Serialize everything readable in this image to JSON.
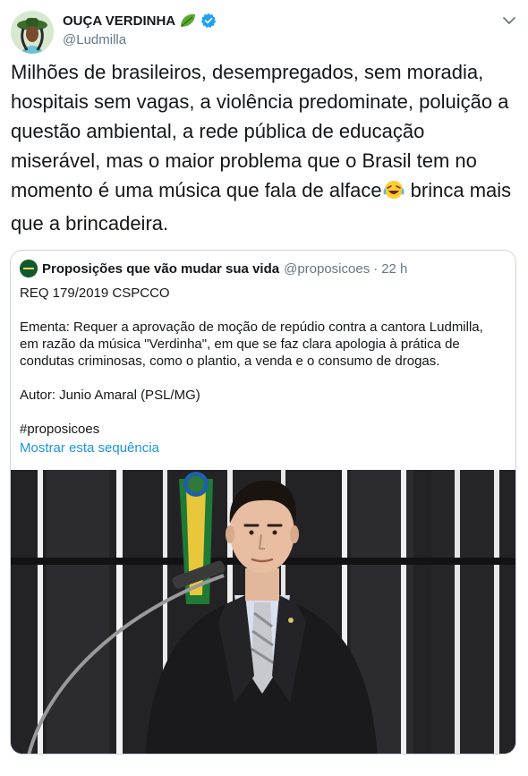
{
  "tweet": {
    "display_name": "OUÇA VERDINHA",
    "handle": "@Ludmilla",
    "text_main": "Milhões de brasileiros, desempregados, sem moradia, hospitais sem vagas, a violência predominate, poluição a questão ambiental, a rede pública de educação miserável, mas o maior problema que o Brasil tem no momento é uma música que fala de alface",
    "text_tail": " brinca mais que a brincadeira."
  },
  "quoted": {
    "name": "Proposições que vão mudar sua vida",
    "handle": "@proposicoes",
    "separator": "·",
    "time": "22 h",
    "lines": {
      "req": "REQ 179/2019 CSPCCO",
      "ementa": "Ementa: Requer a aprovação de moção de repúdio contra a cantora Ludmilla, em razão da música \"Verdinha\", em que se faz clara apologia à prática de condutas criminosas, como o plantio, a venda e o consumo de drogas.",
      "autor": "Autor: Junio Amaral (PSL/MG)",
      "hashtag": "#proposicoes"
    },
    "show_thread": "Mostrar esta sequência"
  },
  "colors": {
    "text": "#14171a",
    "secondary": "#657786",
    "link": "#1b95e0",
    "verified": "#1da1f2",
    "border": "#ccd6dd"
  },
  "icons": {
    "leaf": "leaf-emoji-icon",
    "verified": "verified-badge-icon",
    "caret": "chevron-down-icon",
    "laugh": "tears-of-joy-emoji-icon"
  }
}
